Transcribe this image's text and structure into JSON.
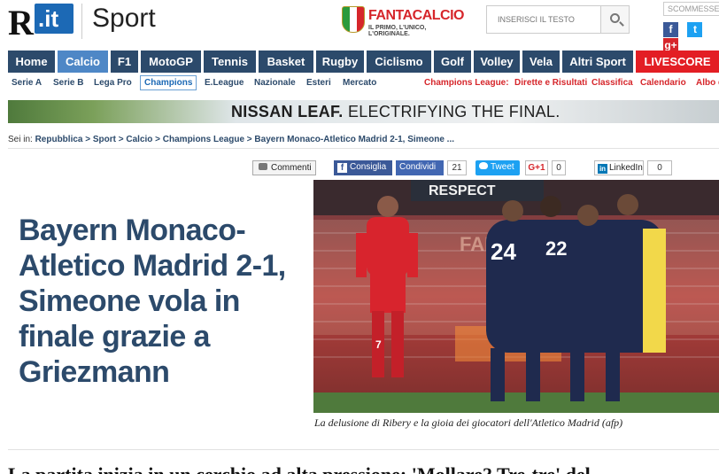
{
  "header": {
    "logo_r": "R",
    "logo_it": ".it",
    "section": "Sport",
    "fantacalcio": {
      "name": "FANTACALCIO",
      "tagline": "IL PRIMO, L'UNICO, L'ORIGINALE."
    },
    "search": {
      "placeholder": "INSERISCI IL TESTO",
      "icon": "search-icon"
    },
    "login_label": "SCOMMESSE",
    "social": [
      "f",
      "t",
      "g+"
    ]
  },
  "nav": {
    "items": [
      "Home",
      "Calcio",
      "F1",
      "MotoGP",
      "Tennis",
      "Basket",
      "Rugby",
      "Ciclismo",
      "Golf",
      "Volley",
      "Vela",
      "Altri Sport",
      "LIVESCORE"
    ],
    "active": "Calcio"
  },
  "subnav": {
    "items": [
      "Serie A",
      "Serie B",
      "Lega Pro",
      "Champions",
      "E.League",
      "Nazionale",
      "Esteri",
      "Mercato"
    ],
    "active": "Champions",
    "cl_items": [
      "Champions League:",
      "Dirette e Risultati",
      "Classifica",
      "Calendario",
      "Albo d'oro"
    ]
  },
  "banner": {
    "brand": "NISSAN LEAF.",
    "slogan": "ELECTRIFYING THE FINAL."
  },
  "breadcrumb": {
    "prefix": "Sei in:",
    "path": "Repubblica > Sport > Calcio > Champions League > Bayern Monaco-Atletico Madrid 2-1, Simeone ..."
  },
  "share": {
    "comments": "Commenti",
    "fb_share": "Consiglia",
    "fb_count_label": "Condividi",
    "fb_count": "21",
    "tweet": "Tweet",
    "gplus": "G+1",
    "gplus_count": "0",
    "linkedin": "LinkedIn",
    "linkedin_count": "0"
  },
  "article": {
    "headline": "Bayern Monaco-Atletico Madrid 2-1, Simeone vola in finale grazie a Griezmann",
    "caption": "La delusione di Ribery e la gioia dei giocatori dell'Atletico Madrid (afp)",
    "photo_banner": "RESPECT",
    "photo_left_text": "FANS",
    "body_start": "La partita inizia in un cerchio ad alta pressione: 'Mollare? Tre-tre' del..."
  },
  "colors": {
    "nav": "#2c4a6b",
    "nav_active": "#4e87c6",
    "live": "#e31e24",
    "headline": "#2c4a6b"
  }
}
